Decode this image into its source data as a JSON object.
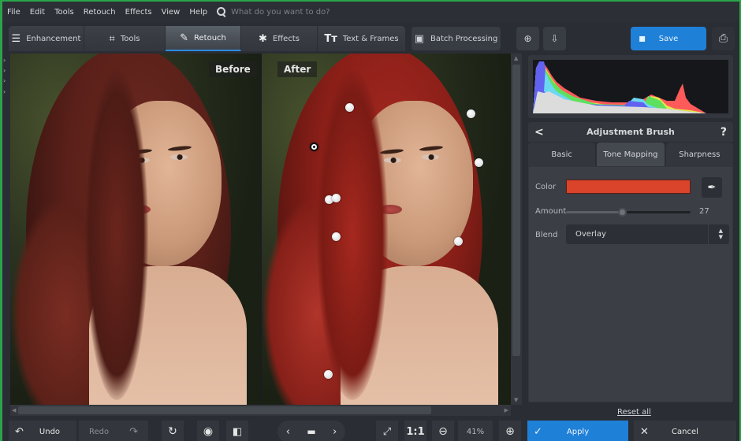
{
  "menu": {
    "items": [
      "File",
      "Edit",
      "Tools",
      "Retouch",
      "Effects",
      "View",
      "Help"
    ],
    "search_placeholder": "What do you want to do?"
  },
  "toolbar": {
    "tabs": [
      {
        "label": "Enhancement",
        "icon": "sliders-icon",
        "active": false
      },
      {
        "label": "Tools",
        "icon": "crop-icon",
        "active": false
      },
      {
        "label": "Retouch",
        "icon": "brush-icon",
        "active": true
      },
      {
        "label": "Effects",
        "icon": "magic-wand-icon",
        "active": false
      },
      {
        "label": "Text & Frames",
        "icon": "text-icon",
        "active": false
      }
    ],
    "batch_label": "Batch Processing",
    "preset_add_icon": "preset-add-icon",
    "preset_download_icon": "preset-download-icon",
    "save_label": "Save",
    "print_icon": "print-icon"
  },
  "canvas": {
    "before_label": "Before",
    "after_label": "After"
  },
  "panel": {
    "title": "Adjustment Brush",
    "back_symbol": "<",
    "help_symbol": "?",
    "subtabs": [
      {
        "label": "Basic",
        "active": false
      },
      {
        "label": "Tone Mapping",
        "active": true
      },
      {
        "label": "Sharpness",
        "active": false
      }
    ],
    "color_label": "Color",
    "color_value": "#d9442a",
    "amount_label": "Amount",
    "amount_value": "27",
    "amount_fraction": 0.45,
    "blend_label": "Blend",
    "blend_value": "Overlay",
    "reset_label": "Reset all"
  },
  "bottom": {
    "undo_label": "Undo",
    "redo_label": "Redo",
    "fit_icon": "fit-screen-icon",
    "one_to_one_label": "1:1",
    "zoom_value": "41%",
    "apply_label": "Apply",
    "cancel_label": "Cancel"
  },
  "colors": {
    "accent": "#1f80d8",
    "brush_color": "#d9442a",
    "frame": "#2aa44a"
  }
}
